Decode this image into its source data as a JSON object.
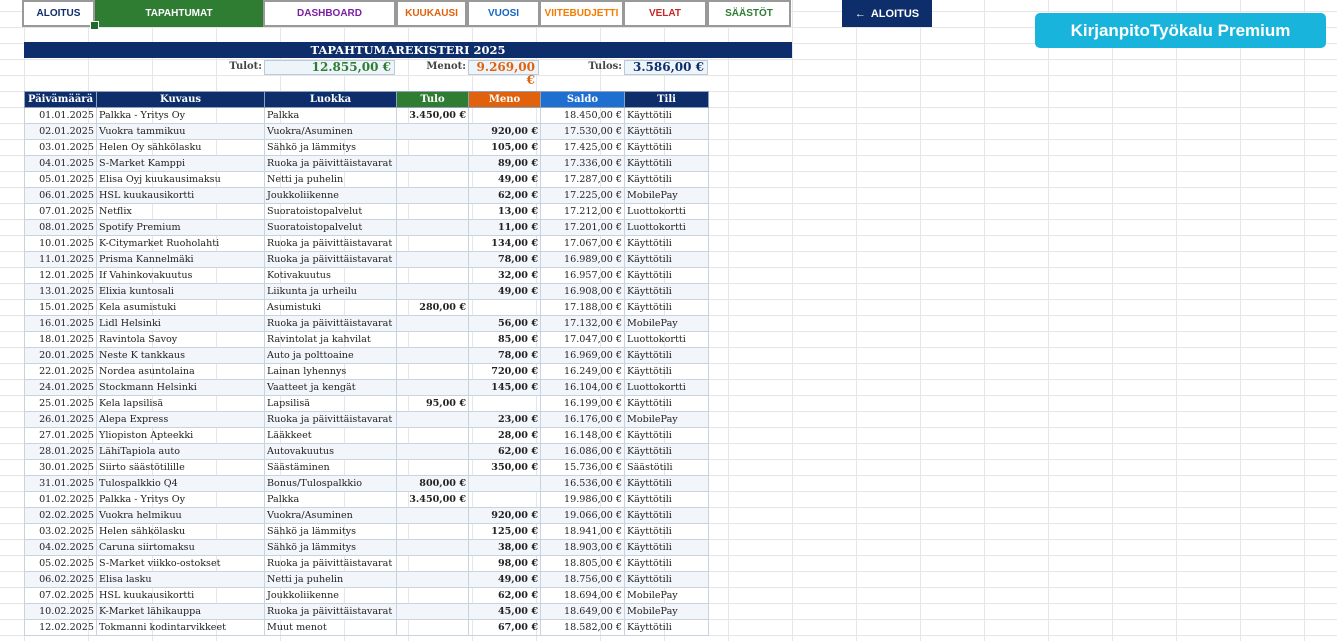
{
  "nav": {
    "tabs": [
      {
        "label": "ALOITUS",
        "color": "#0d2d6b"
      },
      {
        "label": "TAPAHTUMAT",
        "color": "#ffffff"
      },
      {
        "label": "DASHBOARD",
        "color": "#7b1fa2"
      },
      {
        "label": "KUUKAUSI",
        "color": "#e0620d"
      },
      {
        "label": "VUOSI",
        "color": "#1565c0"
      },
      {
        "label": "VIITEBUDJETTI",
        "color": "#f57c00"
      },
      {
        "label": "VELAT",
        "color": "#c62828"
      },
      {
        "label": "SÄÄSTÖT",
        "color": "#2e7d32"
      }
    ],
    "active_tab": "TAPAHTUMAT",
    "back_label": "ALOITUS",
    "back_icon": "arrow-left-icon"
  },
  "brand": {
    "label": "KirjanpitoTyökalu Premium",
    "color": "#18b4dc"
  },
  "register": {
    "title": "TAPAHTUMAREKISTERI 2025",
    "summary": {
      "income_label": "Tulot:",
      "income_value": "12.855,00 €",
      "expense_label": "Menot:",
      "expense_value": "9.269,00 €",
      "result_label": "Tulos:",
      "result_value": "3.586,00 €"
    },
    "columns": [
      {
        "label": "Päivämäärä",
        "color": "#0d2d6b"
      },
      {
        "label": "Kuvaus",
        "color": "#0d2d6b"
      },
      {
        "label": "Luokka",
        "color": "#0d2d6b"
      },
      {
        "label": "Tulo",
        "color": "#2e7d32"
      },
      {
        "label": "Meno",
        "color": "#e0620d"
      },
      {
        "label": "Saldo",
        "color": "#1f6fd1"
      },
      {
        "label": "Tili",
        "color": "#0d2d6b"
      }
    ],
    "rows": [
      [
        "01.01.2025",
        "Palkka - Yritys Oy",
        "Palkka",
        "3.450,00 €",
        "",
        "18.450,00 €",
        "Käyttötili"
      ],
      [
        "02.01.2025",
        "Vuokra tammikuu",
        "Vuokra/Asuminen",
        "",
        "920,00 €",
        "17.530,00 €",
        "Käyttötili"
      ],
      [
        "03.01.2025",
        "Helen Oy sähkölasku",
        "Sähkö ja lämmitys",
        "",
        "105,00 €",
        "17.425,00 €",
        "Käyttötili"
      ],
      [
        "04.01.2025",
        "S-Market Kamppi",
        "Ruoka ja päivittäistavarat",
        "",
        "89,00 €",
        "17.336,00 €",
        "Käyttötili"
      ],
      [
        "05.01.2025",
        "Elisa Oyj kuukausimaksu",
        "Netti ja puhelin",
        "",
        "49,00 €",
        "17.287,00 €",
        "Käyttötili"
      ],
      [
        "06.01.2025",
        "HSL kuukausikortti",
        "Joukkoliikenne",
        "",
        "62,00 €",
        "17.225,00 €",
        "MobilePay"
      ],
      [
        "07.01.2025",
        "Netflix",
        "Suoratoistopalvelut",
        "",
        "13,00 €",
        "17.212,00 €",
        "Luottokortti"
      ],
      [
        "08.01.2025",
        "Spotify Premium",
        "Suoratoistopalvelut",
        "",
        "11,00 €",
        "17.201,00 €",
        "Luottokortti"
      ],
      [
        "10.01.2025",
        "K-Citymarket Ruoholahti",
        "Ruoka ja päivittäistavarat",
        "",
        "134,00 €",
        "17.067,00 €",
        "Käyttötili"
      ],
      [
        "11.01.2025",
        "Prisma Kannelmäki",
        "Ruoka ja päivittäistavarat",
        "",
        "78,00 €",
        "16.989,00 €",
        "Käyttötili"
      ],
      [
        "12.01.2025",
        "If Vahinkovakuutus",
        "Kotivakuutus",
        "",
        "32,00 €",
        "16.957,00 €",
        "Käyttötili"
      ],
      [
        "13.01.2025",
        "Elixia kuntosali",
        "Liikunta ja urheilu",
        "",
        "49,00 €",
        "16.908,00 €",
        "Käyttötili"
      ],
      [
        "15.01.2025",
        "Kela asumistuki",
        "Asumistuki",
        "280,00 €",
        "",
        "17.188,00 €",
        "Käyttötili"
      ],
      [
        "16.01.2025",
        "Lidl Helsinki",
        "Ruoka ja päivittäistavarat",
        "",
        "56,00 €",
        "17.132,00 €",
        "MobilePay"
      ],
      [
        "18.01.2025",
        "Ravintola Savoy",
        "Ravintolat ja kahvilat",
        "",
        "85,00 €",
        "17.047,00 €",
        "Luottokortti"
      ],
      [
        "20.01.2025",
        "Neste K tankkaus",
        "Auto ja polttoaine",
        "",
        "78,00 €",
        "16.969,00 €",
        "Käyttötili"
      ],
      [
        "22.01.2025",
        "Nordea asuntolaina",
        "Lainan lyhennys",
        "",
        "720,00 €",
        "16.249,00 €",
        "Käyttötili"
      ],
      [
        "24.01.2025",
        "Stockmann Helsinki",
        "Vaatteet ja kengät",
        "",
        "145,00 €",
        "16.104,00 €",
        "Luottokortti"
      ],
      [
        "25.01.2025",
        "Kela lapsilisä",
        "Lapsilisä",
        "95,00 €",
        "",
        "16.199,00 €",
        "Käyttötili"
      ],
      [
        "26.01.2025",
        "Alepa Express",
        "Ruoka ja päivittäistavarat",
        "",
        "23,00 €",
        "16.176,00 €",
        "MobilePay"
      ],
      [
        "27.01.2025",
        "Yliopiston Apteekki",
        "Lääkkeet",
        "",
        "28,00 €",
        "16.148,00 €",
        "Käyttötili"
      ],
      [
        "28.01.2025",
        "LähiTapiola auto",
        "Autovakuutus",
        "",
        "62,00 €",
        "16.086,00 €",
        "Käyttötili"
      ],
      [
        "30.01.2025",
        "Siirto säästötilille",
        "Säästäminen",
        "",
        "350,00 €",
        "15.736,00 €",
        "Säästötili"
      ],
      [
        "31.01.2025",
        "Tulospalkkio Q4",
        "Bonus/Tulospalkkio",
        "800,00 €",
        "",
        "16.536,00 €",
        "Käyttötili"
      ],
      [
        "01.02.2025",
        "Palkka - Yritys Oy",
        "Palkka",
        "3.450,00 €",
        "",
        "19.986,00 €",
        "Käyttötili"
      ],
      [
        "02.02.2025",
        "Vuokra helmikuu",
        "Vuokra/Asuminen",
        "",
        "920,00 €",
        "19.066,00 €",
        "Käyttötili"
      ],
      [
        "03.02.2025",
        "Helen sähkölasku",
        "Sähkö ja lämmitys",
        "",
        "125,00 €",
        "18.941,00 €",
        "Käyttötili"
      ],
      [
        "04.02.2025",
        "Caruna siirtomaksu",
        "Sähkö ja lämmitys",
        "",
        "38,00 €",
        "18.903,00 €",
        "Käyttötili"
      ],
      [
        "05.02.2025",
        "S-Market viikko-ostokset",
        "Ruoka ja päivittäistavarat",
        "",
        "98,00 €",
        "18.805,00 €",
        "Käyttötili"
      ],
      [
        "06.02.2025",
        "Elisa lasku",
        "Netti ja puhelin",
        "",
        "49,00 €",
        "18.756,00 €",
        "Käyttötili"
      ],
      [
        "07.02.2025",
        "HSL kuukausikortti",
        "Joukkoliikenne",
        "",
        "62,00 €",
        "18.694,00 €",
        "MobilePay"
      ],
      [
        "10.02.2025",
        "K-Market lähikauppa",
        "Ruoka ja päivittäistavarat",
        "",
        "45,00 €",
        "18.649,00 €",
        "MobilePay"
      ],
      [
        "12.02.2025",
        "Tokmanni kodintarvikkeet",
        "Muut menot",
        "",
        "67,00 €",
        "18.582,00 €",
        "Käyttötili"
      ]
    ]
  }
}
